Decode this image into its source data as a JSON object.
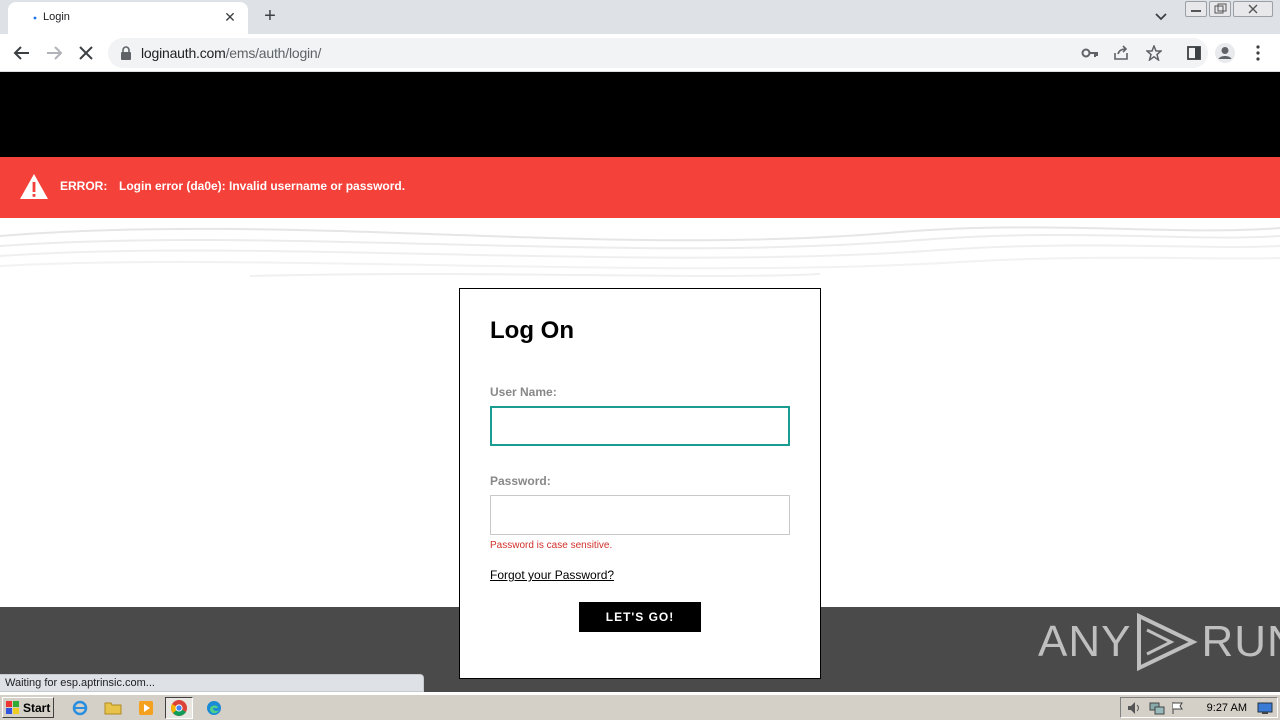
{
  "browser": {
    "tab_title": "Login",
    "url_host": "loginauth.com",
    "url_path": "/ems/auth/login/",
    "status_text": "Waiting for esp.aptrinsic.com..."
  },
  "page": {
    "error_label": "ERROR:",
    "error_message": "Login error (da0e): Invalid username or password.",
    "form": {
      "title": "Log On",
      "username_label": "User Name:",
      "username_value": "",
      "password_label": "Password:",
      "password_value": "",
      "password_hint": "Password is case sensitive.",
      "forgot_link": "Forgot your Password?",
      "submit_label": "LET'S GO!"
    },
    "watermark": "ANY RUN"
  },
  "taskbar": {
    "start_label": "Start",
    "clock": "9:27 AM"
  },
  "colors": {
    "error_bg": "#f4413a",
    "header_bg": "#000000",
    "focus_border": "#1a9c93",
    "footer_bg": "#4a4a4a"
  }
}
